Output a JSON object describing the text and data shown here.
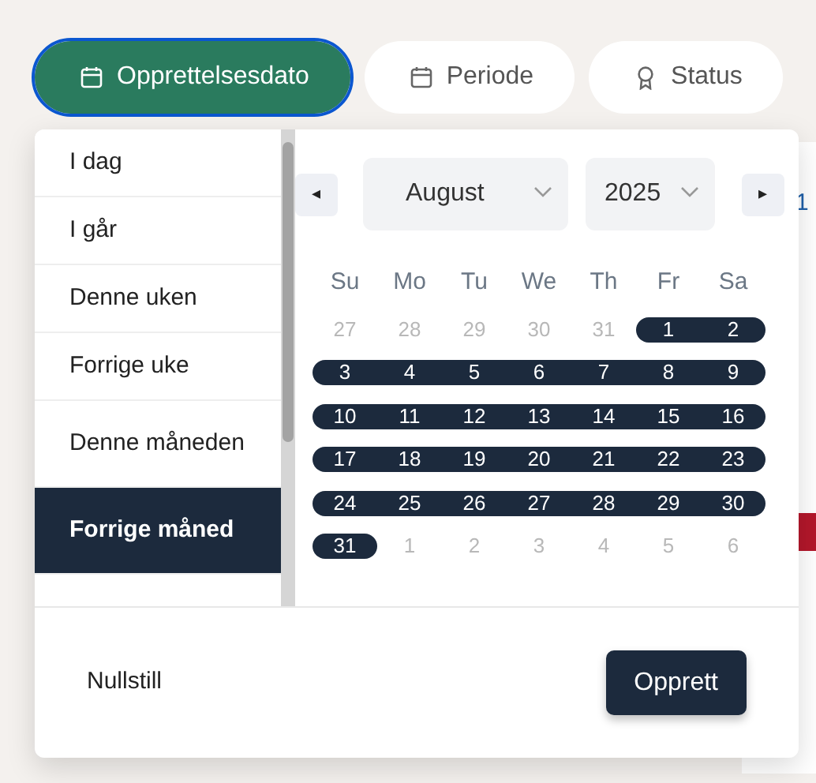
{
  "filters": [
    {
      "label": "Opprettelsesdato",
      "kind": "date",
      "selected": true
    },
    {
      "label": "Periode",
      "kind": "date",
      "selected": false
    },
    {
      "label": "Status",
      "kind": "status",
      "selected": false
    }
  ],
  "background_fragments": [
    {
      "text": "1",
      "color": "#1f5fa8",
      "kind": "text"
    },
    {
      "color": "#b3172b",
      "kind": "badge"
    }
  ],
  "presets": [
    {
      "label": "I dag",
      "selected": false
    },
    {
      "label": "I går",
      "selected": false
    },
    {
      "label": "Denne uken",
      "selected": false
    },
    {
      "label": "Forrige uke",
      "selected": false
    },
    {
      "label": "Denne måneden",
      "selected": false
    },
    {
      "label": "Forrige måned",
      "selected": true
    }
  ],
  "calendar": {
    "prev": "◂",
    "next": "▸",
    "month": "August",
    "year": "2025",
    "weekdays": [
      "Su",
      "Mo",
      "Tu",
      "We",
      "Th",
      "Fr",
      "Sa"
    ],
    "weeks": [
      [
        {
          "label": "27",
          "outside": true,
          "selected": false
        },
        {
          "label": "28",
          "outside": true,
          "selected": false
        },
        {
          "label": "29",
          "outside": true,
          "selected": false
        },
        {
          "label": "30",
          "outside": true,
          "selected": false
        },
        {
          "label": "31",
          "outside": true,
          "selected": false
        },
        {
          "label": "1",
          "outside": false,
          "selected": true
        },
        {
          "label": "2",
          "outside": false,
          "selected": true
        }
      ],
      [
        {
          "label": "3",
          "outside": false,
          "selected": true
        },
        {
          "label": "4",
          "outside": false,
          "selected": true
        },
        {
          "label": "5",
          "outside": false,
          "selected": true
        },
        {
          "label": "6",
          "outside": false,
          "selected": true
        },
        {
          "label": "7",
          "outside": false,
          "selected": true
        },
        {
          "label": "8",
          "outside": false,
          "selected": true
        },
        {
          "label": "9",
          "outside": false,
          "selected": true
        }
      ],
      [
        {
          "label": "10",
          "outside": false,
          "selected": true
        },
        {
          "label": "11",
          "outside": false,
          "selected": true
        },
        {
          "label": "12",
          "outside": false,
          "selected": true
        },
        {
          "label": "13",
          "outside": false,
          "selected": true
        },
        {
          "label": "14",
          "outside": false,
          "selected": true
        },
        {
          "label": "15",
          "outside": false,
          "selected": true
        },
        {
          "label": "16",
          "outside": false,
          "selected": true
        }
      ],
      [
        {
          "label": "17",
          "outside": false,
          "selected": true
        },
        {
          "label": "18",
          "outside": false,
          "selected": true
        },
        {
          "label": "19",
          "outside": false,
          "selected": true
        },
        {
          "label": "20",
          "outside": false,
          "selected": true
        },
        {
          "label": "21",
          "outside": false,
          "selected": true
        },
        {
          "label": "22",
          "outside": false,
          "selected": true
        },
        {
          "label": "23",
          "outside": false,
          "selected": true
        }
      ],
      [
        {
          "label": "24",
          "outside": false,
          "selected": true
        },
        {
          "label": "25",
          "outside": false,
          "selected": true
        },
        {
          "label": "26",
          "outside": false,
          "selected": true
        },
        {
          "label": "27",
          "outside": false,
          "selected": true
        },
        {
          "label": "28",
          "outside": false,
          "selected": true
        },
        {
          "label": "29",
          "outside": false,
          "selected": true
        },
        {
          "label": "30",
          "outside": false,
          "selected": true
        }
      ],
      [
        {
          "label": "31",
          "outside": false,
          "selected": true
        },
        {
          "label": "1",
          "outside": true,
          "selected": false
        },
        {
          "label": "2",
          "outside": true,
          "selected": false
        },
        {
          "label": "3",
          "outside": true,
          "selected": false
        },
        {
          "label": "4",
          "outside": true,
          "selected": false
        },
        {
          "label": "5",
          "outside": true,
          "selected": false
        },
        {
          "label": "6",
          "outside": true,
          "selected": false
        }
      ]
    ]
  },
  "reset_label": "Nullstill",
  "submit_label": "Opprett"
}
